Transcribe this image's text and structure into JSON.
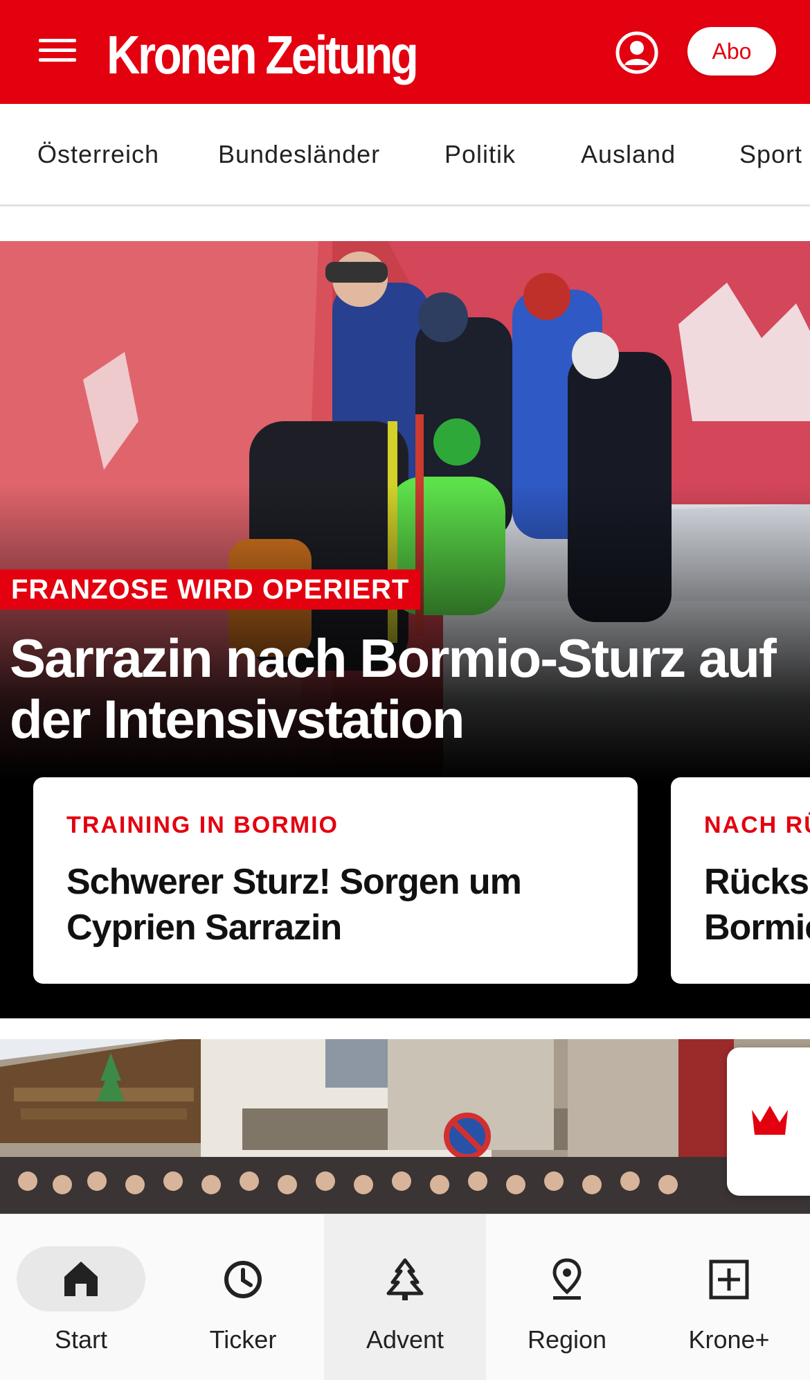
{
  "header": {
    "logo_text": "Kronen Zeitung",
    "abo_label": "Abo",
    "brand_color": "#e3000f",
    "icons": [
      "menu-icon",
      "account-icon"
    ]
  },
  "categories": [
    {
      "label": "Österreich"
    },
    {
      "label": "Bundesländer"
    },
    {
      "label": "Politik"
    },
    {
      "label": "Ausland"
    },
    {
      "label": "Sport"
    }
  ],
  "hero": {
    "kicker": "FRANZOSE WIRD OPERIERT",
    "headline": "Sarrazin nach Bormio-Sturz auf der Intensivstation"
  },
  "teasers": [
    {
      "kicker": "TRAINING IN BORMIO",
      "title": "Schwerer Sturz! Sorgen um Cyprien Sarrazin"
    },
    {
      "kicker": "NACH RÜ",
      "title": "Rücks Bormic"
    }
  ],
  "krone_badge": {
    "icon": "crown-icon"
  },
  "bottom_nav": [
    {
      "label": "Start",
      "icon": "home-icon",
      "active": true
    },
    {
      "label": "Ticker",
      "icon": "clock-icon",
      "active": false
    },
    {
      "label": "Advent",
      "icon": "tree-icon",
      "active": false
    },
    {
      "label": "Region",
      "icon": "location-pin-icon",
      "active": false
    },
    {
      "label": "Krone+",
      "icon": "plus-box-icon",
      "active": false
    }
  ]
}
